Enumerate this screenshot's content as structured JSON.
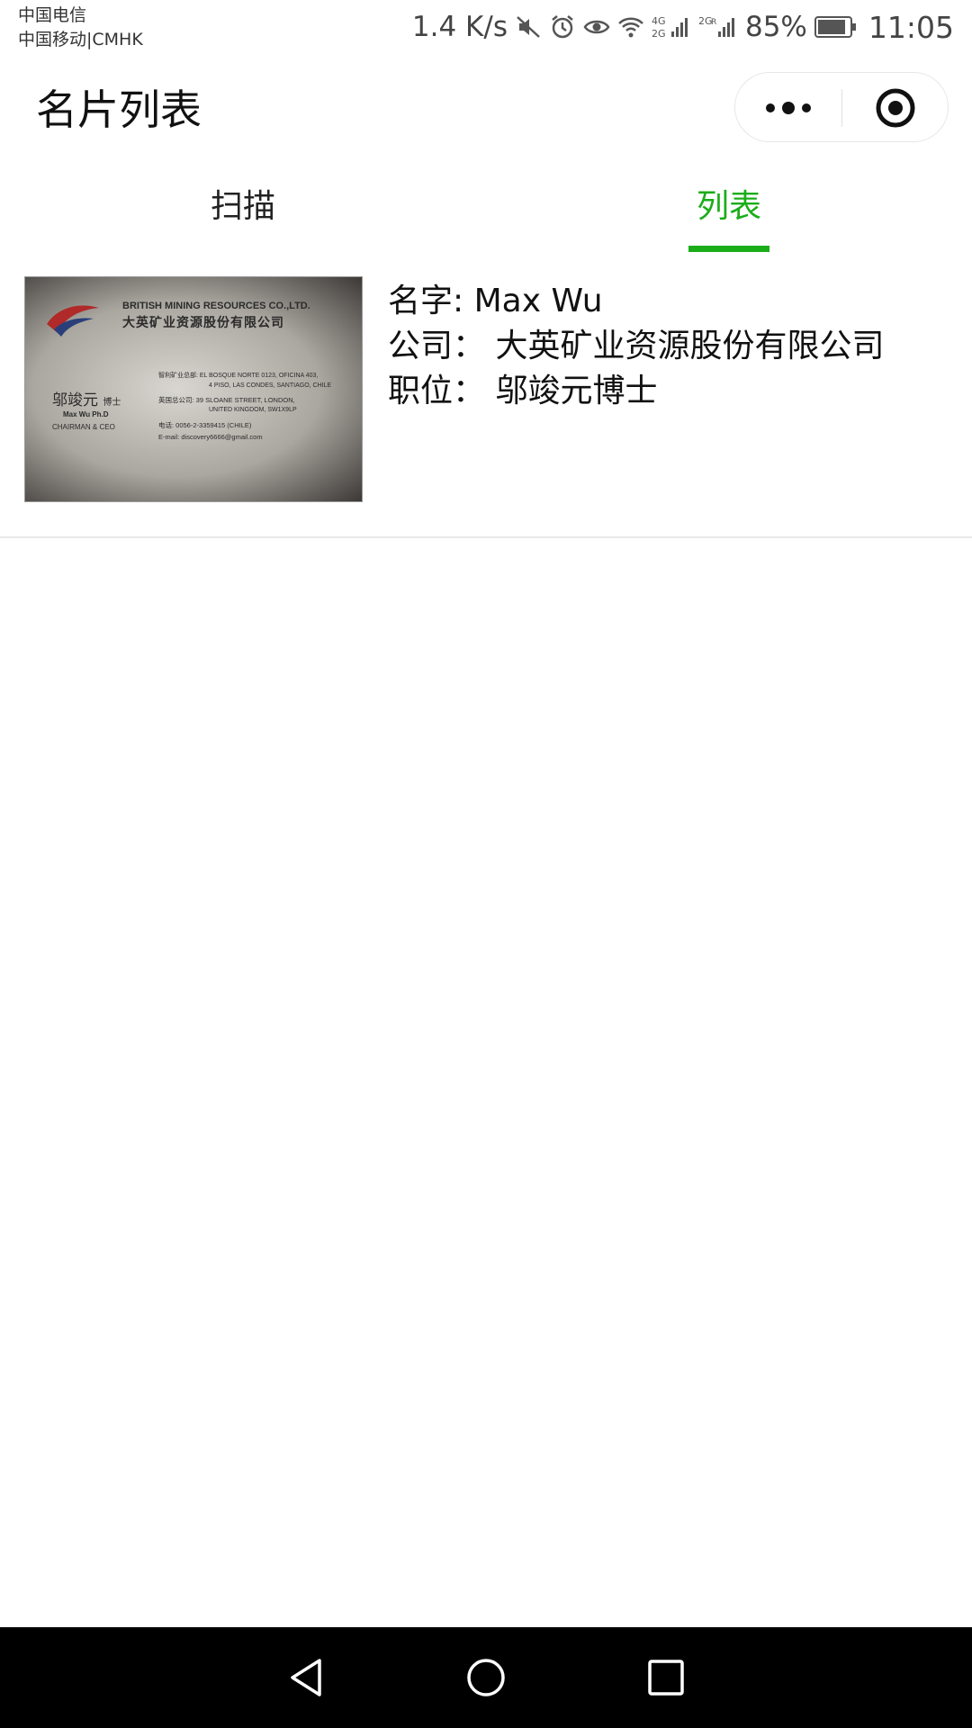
{
  "status_bar": {
    "carrier_1": "中国电信",
    "carrier_2": "中国移动|CMHK",
    "net_speed": "1.4 K/s",
    "battery": "85%",
    "time": "11:05",
    "icons": [
      "mute-icon",
      "alarm-icon",
      "eye-icon",
      "wifi-icon",
      "signal-4g-icon",
      "signal-2g-icon",
      "battery-icon"
    ]
  },
  "nav": {
    "title": "名片列表"
  },
  "tabs": [
    {
      "label": "扫描",
      "active": false
    },
    {
      "label": "列表",
      "active": true
    }
  ],
  "accent_color": "#1aad19",
  "cards": [
    {
      "thumbnail": {
        "company_en": "BRITISH MINING RESOURCES CO.,LTD.",
        "company_cn": "大英矿业资源股份有限公司",
        "person_cn": "邬竣元",
        "person_title_cn": "博士",
        "person_en": "Max Wu Ph.D",
        "role": "CHAIRMAN & CEO",
        "addr_1": "智利矿业总部: EL BOSQUE NORTE 0123, OFICINA 403,",
        "addr_2": "4 PISO, LAS CONDES, SANTIAGO, CHILE",
        "addr_3": "英国总公司: 39 SLOANE STREET, LONDON,",
        "addr_4": "UNITED KINGDOM, SW1X9LP",
        "phone": "电话: 0056-2-3359415 (CHILE)",
        "email": "E-mail: discovery6666@gmail.com"
      },
      "name_line": "名字: Max Wu",
      "company_line": "公司：  大英矿业资源股份有限公司",
      "position_line": "职位：  邬竣元博士"
    }
  ]
}
